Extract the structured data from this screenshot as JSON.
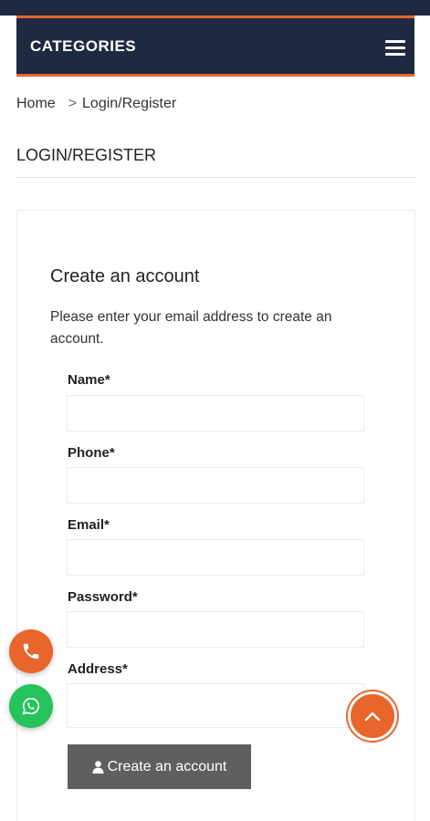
{
  "header": {
    "categories_label": "CATEGORIES",
    "accent_color": "#e8652b",
    "bar_color": "#1f2a40"
  },
  "breadcrumb": {
    "home": "Home",
    "separator": ">",
    "current": "Login/Register"
  },
  "page": {
    "title": "LOGIN/REGISTER"
  },
  "form": {
    "heading": "Create an account",
    "description": "Please enter your email address to create an account.",
    "fields": [
      {
        "label": "Name*",
        "value": ""
      },
      {
        "label": "Phone*",
        "value": ""
      },
      {
        "label": "Email*",
        "value": ""
      },
      {
        "label": "Password*",
        "value": ""
      },
      {
        "label": "Address*",
        "value": ""
      }
    ],
    "submit_label": "Create an account",
    "submit_icon": "user-icon"
  },
  "floating": {
    "call_icon": "phone-icon",
    "whatsapp_icon": "whatsapp-icon",
    "scroll_top_icon": "chevron-up-icon"
  }
}
